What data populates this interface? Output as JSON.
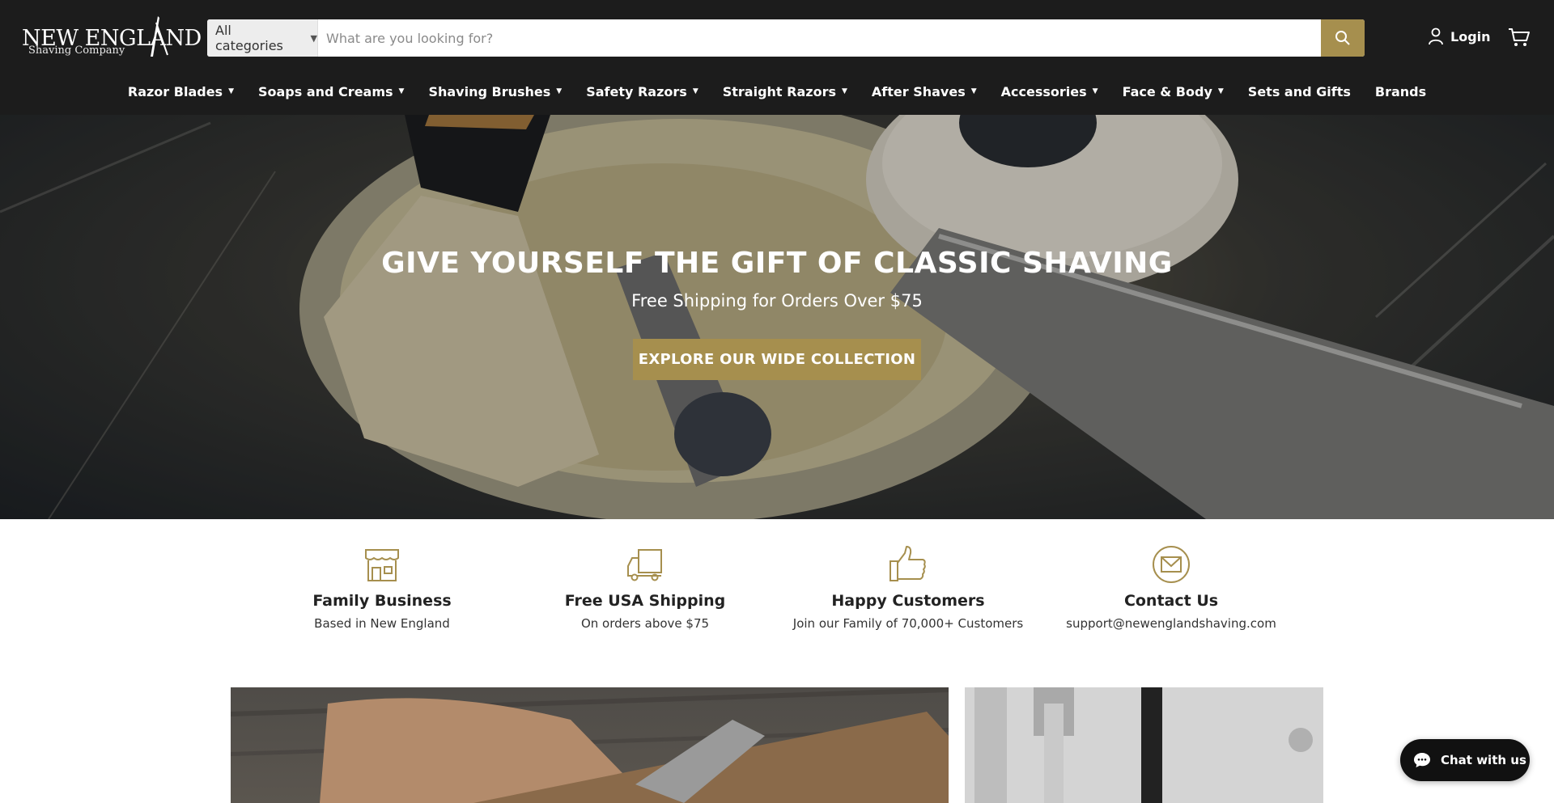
{
  "header": {
    "logo": {
      "main": "NEW ENGLAND",
      "sub": "Shaving Company"
    },
    "search": {
      "category": "All categories",
      "placeholder": "What are you looking for?",
      "value": ""
    },
    "login_label": "Login",
    "icons": {
      "search": "search-icon",
      "user": "user-icon",
      "cart": "cart-icon"
    }
  },
  "nav": {
    "items": [
      {
        "label": "Razor Blades",
        "dropdown": true
      },
      {
        "label": "Soaps and Creams",
        "dropdown": true
      },
      {
        "label": "Shaving Brushes",
        "dropdown": true
      },
      {
        "label": "Safety Razors",
        "dropdown": true
      },
      {
        "label": "Straight Razors",
        "dropdown": true
      },
      {
        "label": "After Shaves",
        "dropdown": true
      },
      {
        "label": "Accessories",
        "dropdown": true
      },
      {
        "label": "Face & Body",
        "dropdown": true
      },
      {
        "label": "Sets and Gifts",
        "dropdown": false
      },
      {
        "label": "Brands",
        "dropdown": false
      }
    ]
  },
  "hero": {
    "title": "GIVE YOURSELF THE GIFT OF CLASSIC SHAVING",
    "subtitle": "Free Shipping for Orders Over $75",
    "cta": "EXPLORE OUR WIDE COLLECTION"
  },
  "features": [
    {
      "title": "Family Business",
      "desc": "Based in New England",
      "icon": "storefront-icon"
    },
    {
      "title": "Free USA Shipping",
      "desc": "On orders above $75",
      "icon": "delivery-truck-icon"
    },
    {
      "title": "Happy Customers",
      "desc": "Join our Family of 70,000+ Customers",
      "icon": "thumbs-up-icon"
    },
    {
      "title": "Contact Us",
      "desc": "support@newenglandshaving.com",
      "icon": "envelope-icon"
    }
  ],
  "chat": {
    "label": "Chat with us",
    "icon": "chat-bubble-icon"
  },
  "colors": {
    "header_bg": "#1c1c1c",
    "accent": "#a68f4e",
    "text": "#222222"
  }
}
